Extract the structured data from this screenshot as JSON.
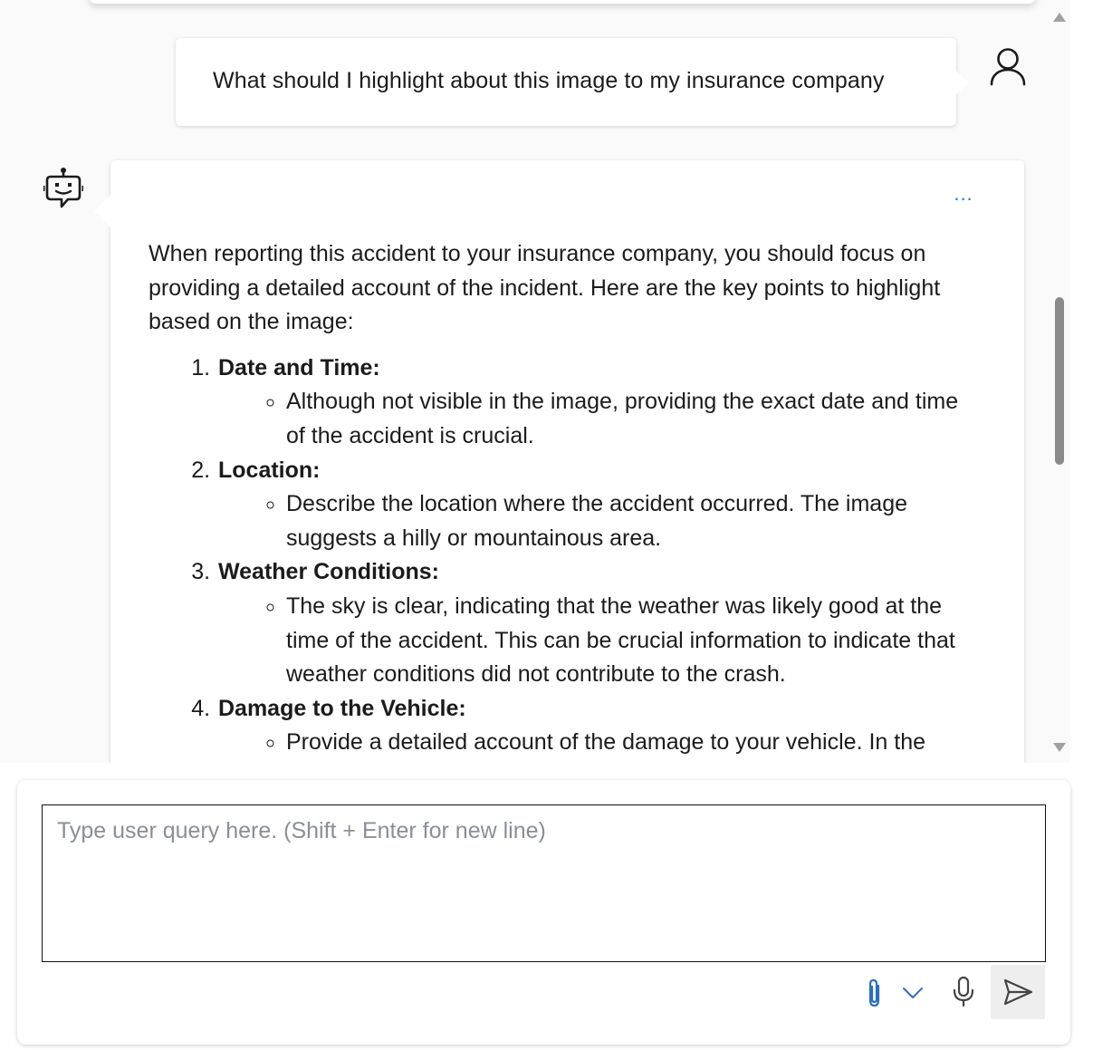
{
  "conversation": {
    "user_message": "What should I highlight about this image to my insurance company",
    "bot_message": {
      "more_options_label": "...",
      "intro": "When reporting this accident to your insurance company, you should focus on providing a detailed account of the incident. Here are the key points to highlight based on the image:",
      "points": [
        {
          "title": "Date and Time:",
          "details": [
            "Although not visible in the image, providing the exact date and time of the accident is crucial."
          ]
        },
        {
          "title": "Location:",
          "details": [
            "Describe the location where the accident occurred. The image suggests a hilly or mountainous area."
          ]
        },
        {
          "title": "Weather Conditions:",
          "details": [
            "The sky is clear, indicating that the weather was likely good at the time of the accident. This can be crucial information to indicate that weather conditions did not contribute to the crash."
          ]
        },
        {
          "title": "Damage to the Vehicle:",
          "details": [
            "Provide a detailed account of the damage to your vehicle. In the"
          ]
        }
      ]
    }
  },
  "composer": {
    "placeholder": "Type user query here. (Shift + Enter for new line)",
    "value": ""
  },
  "icons": {
    "user_avatar": "person-outline-icon",
    "bot_avatar": "bot-chat-icon",
    "attach": "paperclip-icon",
    "attach_menu": "chevron-down-icon",
    "microphone": "microphone-icon",
    "send": "send-arrow-icon"
  },
  "colors": {
    "accent": "#2b6fc0",
    "background": "#fafafa",
    "card": "#ffffff",
    "placeholder": "#8a8f96",
    "send_button_bg": "#eeeeee"
  }
}
